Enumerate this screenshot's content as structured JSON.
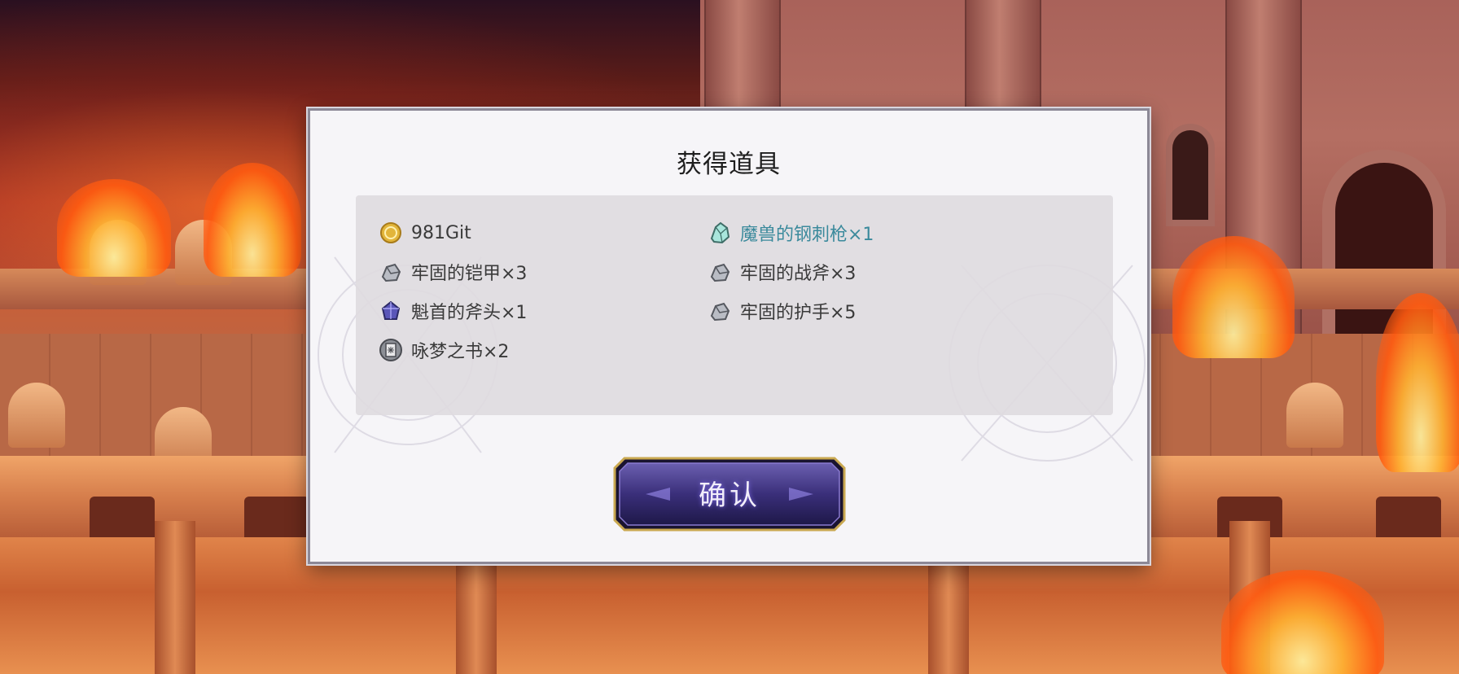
{
  "dialog": {
    "title": "获得道具",
    "confirm_label": "确认"
  },
  "items": [
    {
      "label": "981Git",
      "icon": "gold-coin-icon",
      "rare": false
    },
    {
      "label": "魔兽的钢刺枪×1",
      "icon": "crystal-material-icon",
      "rare": true
    },
    {
      "label": "牢固的铠甲×3",
      "icon": "ore-material-icon",
      "rare": false
    },
    {
      "label": "牢固的战斧×3",
      "icon": "ore-material-icon",
      "rare": false
    },
    {
      "label": "魁首的斧头×1",
      "icon": "purple-crystal-icon",
      "rare": false
    },
    {
      "label": "牢固的护手×5",
      "icon": "ore-material-icon",
      "rare": false
    },
    {
      "label": "咏梦之书×2",
      "icon": "book-icon",
      "rare": false
    }
  ],
  "colors": {
    "rare_text": "#3b8a9c",
    "normal_text": "#3a3a3a",
    "button_fill": "#3a2f7a",
    "button_border": "#c9a850"
  }
}
